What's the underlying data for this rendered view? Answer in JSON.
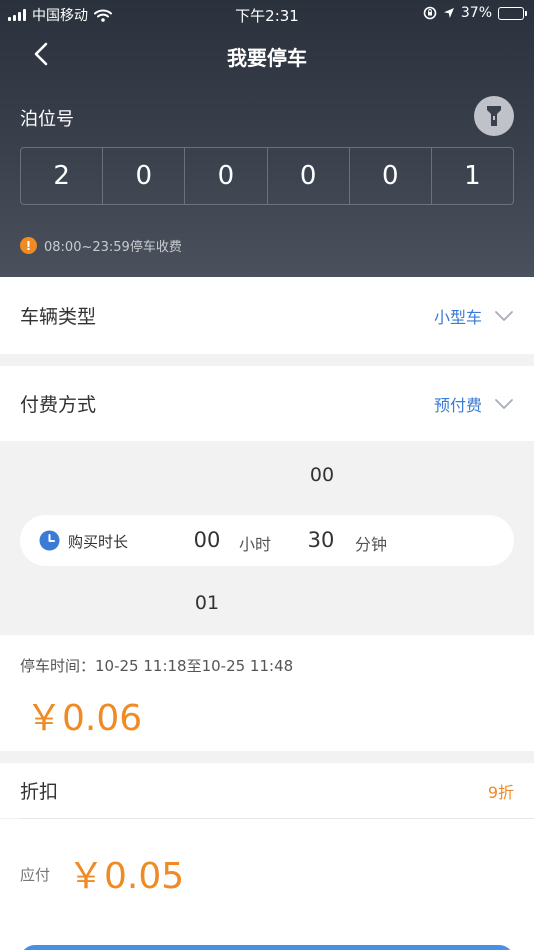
{
  "status_bar": {
    "carrier": "中国移动",
    "time": "下午2:31",
    "battery_percent": "37%",
    "battery_level": 0.37,
    "icons": [
      "signal-icon",
      "wifi-icon",
      "rotation-lock-icon",
      "location-icon",
      "battery-icon"
    ]
  },
  "nav": {
    "title": "我要停车",
    "back_icon": "chevron-left-icon"
  },
  "berth": {
    "label": "泊位号",
    "digits": [
      "2",
      "0",
      "0",
      "0",
      "0",
      "1"
    ],
    "flash_icon": "flashlight-icon"
  },
  "notice": {
    "text": "08:00~23:59停车收费",
    "icon": "warning-icon"
  },
  "vehicle_type": {
    "label": "车辆类型",
    "value": "小型车"
  },
  "payment_method": {
    "label": "付费方式",
    "value": "预付费"
  },
  "duration_picker": {
    "label": "购买时长",
    "hours": "00",
    "hour_unit": "小时",
    "minutes": "30",
    "minute_unit": "分钟",
    "adjacent_above": "00",
    "adjacent_below": "01"
  },
  "parking_time": {
    "text": "停车时间：10-25 11:18至10-25 11:48",
    "price": "￥0.06"
  },
  "discount": {
    "label": "折扣",
    "value": "9折"
  },
  "payable": {
    "label": "应付",
    "amount": "￥0.05"
  },
  "colors": {
    "accent_blue": "#3a7bd5",
    "price_orange": "#f08a24",
    "header_dark": "#2f3540"
  }
}
